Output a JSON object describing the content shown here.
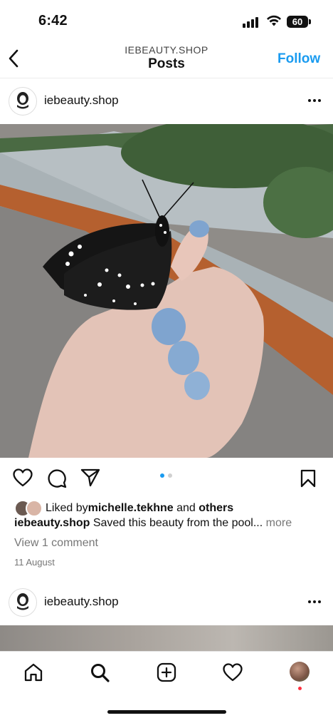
{
  "status": {
    "time": "6:42",
    "battery": "60"
  },
  "header": {
    "subtitle": "IEBEAUTY.SHOP",
    "title": "Posts",
    "follow_label": "Follow"
  },
  "posts": [
    {
      "username": "iebeauty.shop",
      "avatar_text": "iebeauty",
      "carousel": {
        "count": 2,
        "active": 1
      },
      "likes": {
        "prefix": "Liked by ",
        "user": "michelle.tekhne",
        "mid": " and ",
        "others": "others"
      },
      "caption": {
        "user": "iebeauty.shop",
        "text": " Saved this beauty from the pool...",
        "more": " more"
      },
      "comments_link": "View 1 comment",
      "date": "11 August"
    },
    {
      "username": "iebeauty.shop",
      "avatar_text": "iebeauty"
    }
  ],
  "tabbar": [
    "home",
    "search",
    "create",
    "activity",
    "profile"
  ],
  "colors": {
    "accent": "#1a9bf0",
    "notification_dot": "#ff3040"
  }
}
